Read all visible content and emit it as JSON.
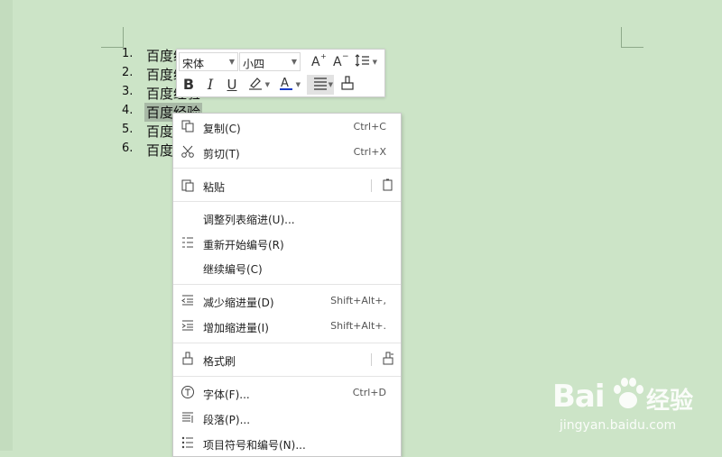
{
  "document": {
    "list_items": [
      {
        "num": "1.",
        "text": "百度经验"
      },
      {
        "num": "2.",
        "text": "百度经验"
      },
      {
        "num": "3.",
        "text": "百度经验"
      },
      {
        "num": "4.",
        "text": "百度经验"
      },
      {
        "num": "5.",
        "text": "百度经验"
      },
      {
        "num": "6.",
        "text": "百度经验"
      }
    ]
  },
  "mini_toolbar": {
    "font_name": "宋体",
    "font_size": "小四",
    "icons": [
      "grow-font-icon",
      "shrink-font-icon",
      "line-spacing-icon",
      "bold-icon",
      "italic-icon",
      "underline-icon",
      "highlight-icon",
      "font-color-icon",
      "align-icon",
      "format-painter-icon"
    ],
    "font_color": "#1a3cc8",
    "highlight_color": "#888888"
  },
  "context_menu": {
    "items": [
      {
        "label": "复制(C)",
        "shortcut": "Ctrl+C",
        "icon": "copy-icon"
      },
      {
        "label": "剪切(T)",
        "shortcut": "Ctrl+X",
        "icon": "scissors-icon"
      },
      {
        "label": "粘贴",
        "shortcut": "",
        "icon": "paste-icon"
      },
      {
        "label": "调整列表缩进(U)...",
        "shortcut": "",
        "icon": ""
      },
      {
        "label": "重新开始编号(R)",
        "shortcut": "",
        "icon": "restart-numbering-icon"
      },
      {
        "label": "继续编号(C)",
        "shortcut": "",
        "icon": ""
      },
      {
        "label": "减少缩进量(D)",
        "shortcut": "Shift+Alt+,",
        "icon": "decrease-indent-icon"
      },
      {
        "label": "增加缩进量(I)",
        "shortcut": "Shift+Alt+.",
        "icon": "increase-indent-icon"
      },
      {
        "label": "格式刷",
        "shortcut": "",
        "icon": "format-painter-icon"
      },
      {
        "label": "字体(F)...",
        "shortcut": "Ctrl+D",
        "icon": "font-icon"
      },
      {
        "label": "段落(P)...",
        "shortcut": "",
        "icon": "paragraph-icon"
      },
      {
        "label": "项目符号和编号(N)...",
        "shortcut": "",
        "icon": "bullets-numbering-icon"
      }
    ]
  },
  "watermark": {
    "brand": "Bai",
    "cn": "经验",
    "url": "jingyan.baidu.com"
  }
}
